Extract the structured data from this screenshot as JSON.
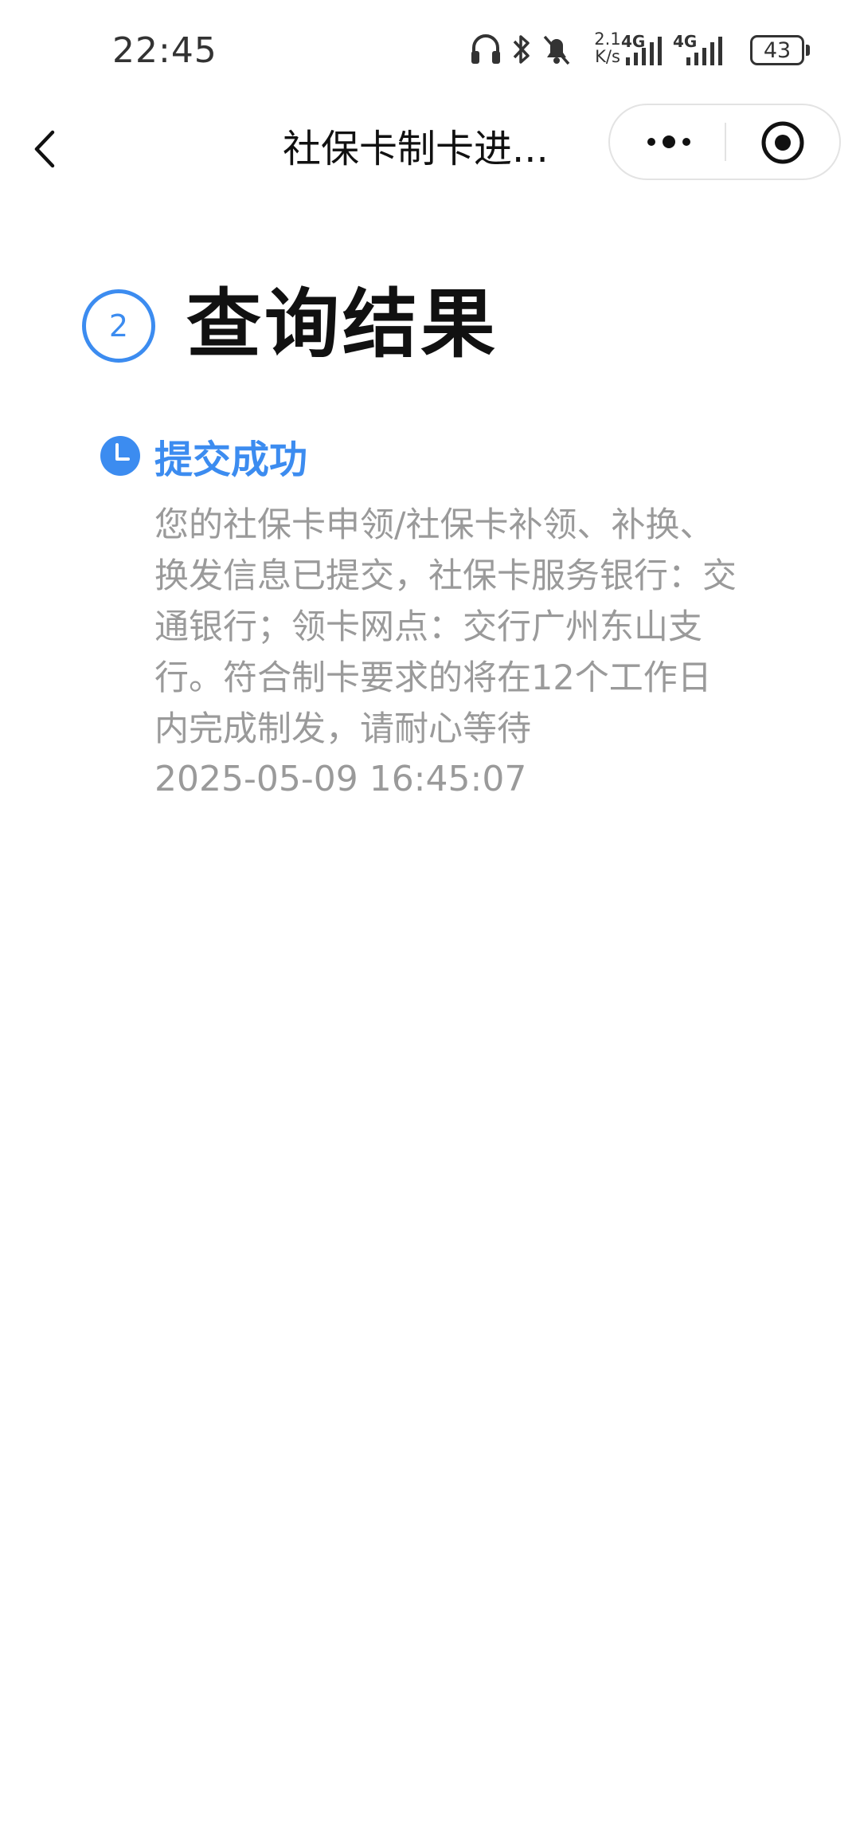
{
  "status_bar": {
    "time": "22:45",
    "icons": [
      "headphones-icon",
      "bluetooth-icon",
      "mute-bell-icon"
    ],
    "net_speed_value": "2.1",
    "net_speed_unit": "K/s",
    "signal1_label": "4G",
    "signal2_label": "4G",
    "battery": "43"
  },
  "nav": {
    "title": "社保卡制卡进...",
    "back_icon": "back-arrow-icon",
    "more_icon": "more-dots-icon",
    "close_icon": "mini-program-close-icon"
  },
  "step": {
    "number": "2",
    "title": "查询结果"
  },
  "result": {
    "status_icon": "clock-icon",
    "status_color": "#3c8cf0",
    "status": "提交成功",
    "description": "您的社保卡申领/社保卡补领、补换、换发信息已提交，社保卡服务银行：交通银行；领卡网点：交行广州东山支行。符合制卡要求的将在12个工作日内完成制发，请耐心等待",
    "timestamp": "2025-05-09 16:45:07"
  }
}
